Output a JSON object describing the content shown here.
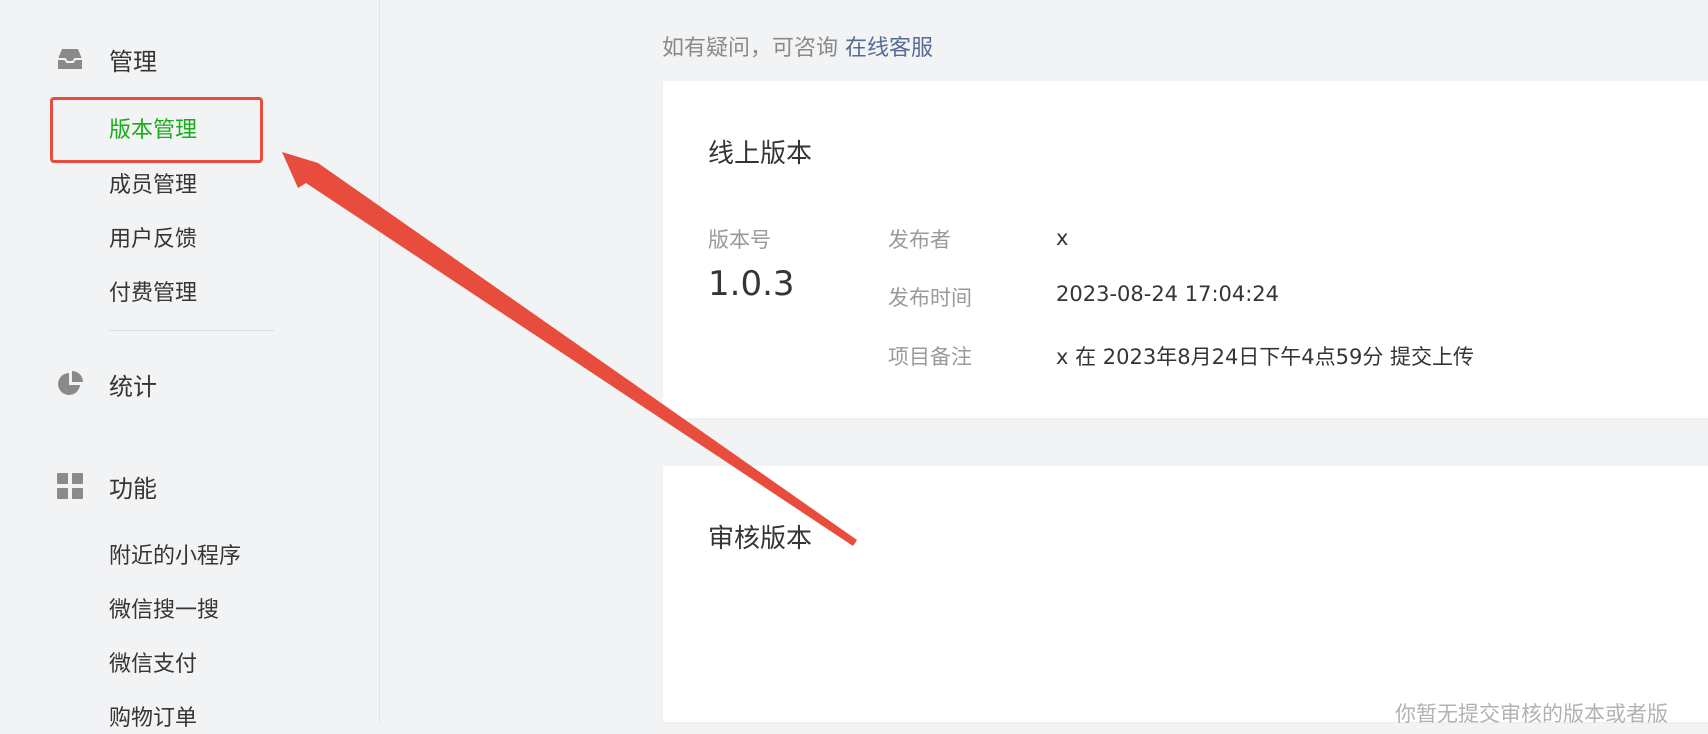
{
  "sidebar": {
    "sections": [
      {
        "label": "管理",
        "icon": "inbox-icon"
      },
      {
        "label": "统计",
        "icon": "pie-chart-icon"
      },
      {
        "label": "功能",
        "icon": "grid-icon"
      }
    ],
    "manage_items": [
      "版本管理",
      "成员管理",
      "用户反馈",
      "付费管理"
    ],
    "feature_items": [
      "附近的小程序",
      "微信搜一搜",
      "微信支付",
      "购物订单"
    ]
  },
  "notice": {
    "text": "如有疑问，可咨询",
    "link": "在线客服"
  },
  "online_version": {
    "title": "线上版本",
    "version_label": "版本号",
    "version_value": "1.0.3",
    "publisher_label": "发布者",
    "publisher_value": "x",
    "time_label": "发布时间",
    "time_value": "2023-08-24 17:04:24",
    "note_label": "项目备注",
    "note_value": "x 在 2023年8月24日下午4点59分 提交上传"
  },
  "review_version": {
    "title": "审核版本",
    "empty_text": "你暂无提交审核的版本或者版"
  },
  "colors": {
    "active": "#1aad19",
    "link": "#576b95",
    "annotation": "#e74c3c"
  }
}
